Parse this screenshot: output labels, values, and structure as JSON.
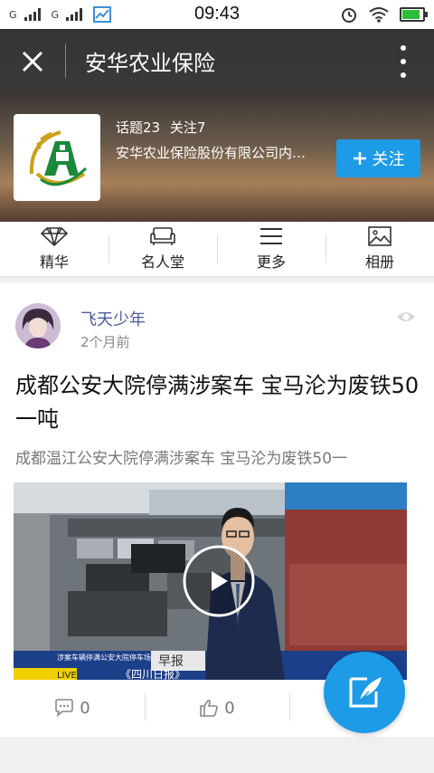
{
  "status_bar": {
    "sim1": "G",
    "sim2": "G",
    "time": "09:43",
    "battery_level": 0.95
  },
  "nav": {
    "title": "安华农业保险"
  },
  "profile": {
    "topics": "话题23",
    "follows": "关注7",
    "description": "安华农业保险股份有限公司内…",
    "follow_label": "关注"
  },
  "tabs": [
    {
      "label": "精华",
      "icon": "diamond-icon"
    },
    {
      "label": "名人堂",
      "icon": "sofa-icon"
    },
    {
      "label": "更多",
      "icon": "menu-icon"
    },
    {
      "label": "相册",
      "icon": "image-icon"
    }
  ],
  "post": {
    "author": "飞天少年",
    "time": "2个月前",
    "title": "成都公安大院停满涉案车 宝马沦为废铁50一吨",
    "summary": "成都温江公安大院停满涉案车 宝马沦为废铁50一",
    "video": {
      "badge": "早报",
      "ticker": "《四川日报》",
      "live": "LIVE",
      "caption": "涉案车辆停满公安大院停车场"
    },
    "comment_count": "0",
    "like_count": "0"
  },
  "colors": {
    "accent": "#1e9be6",
    "author": "#4a5d9a",
    "logo_green": "#1a8a3a",
    "logo_gold": "#c9a21a"
  }
}
